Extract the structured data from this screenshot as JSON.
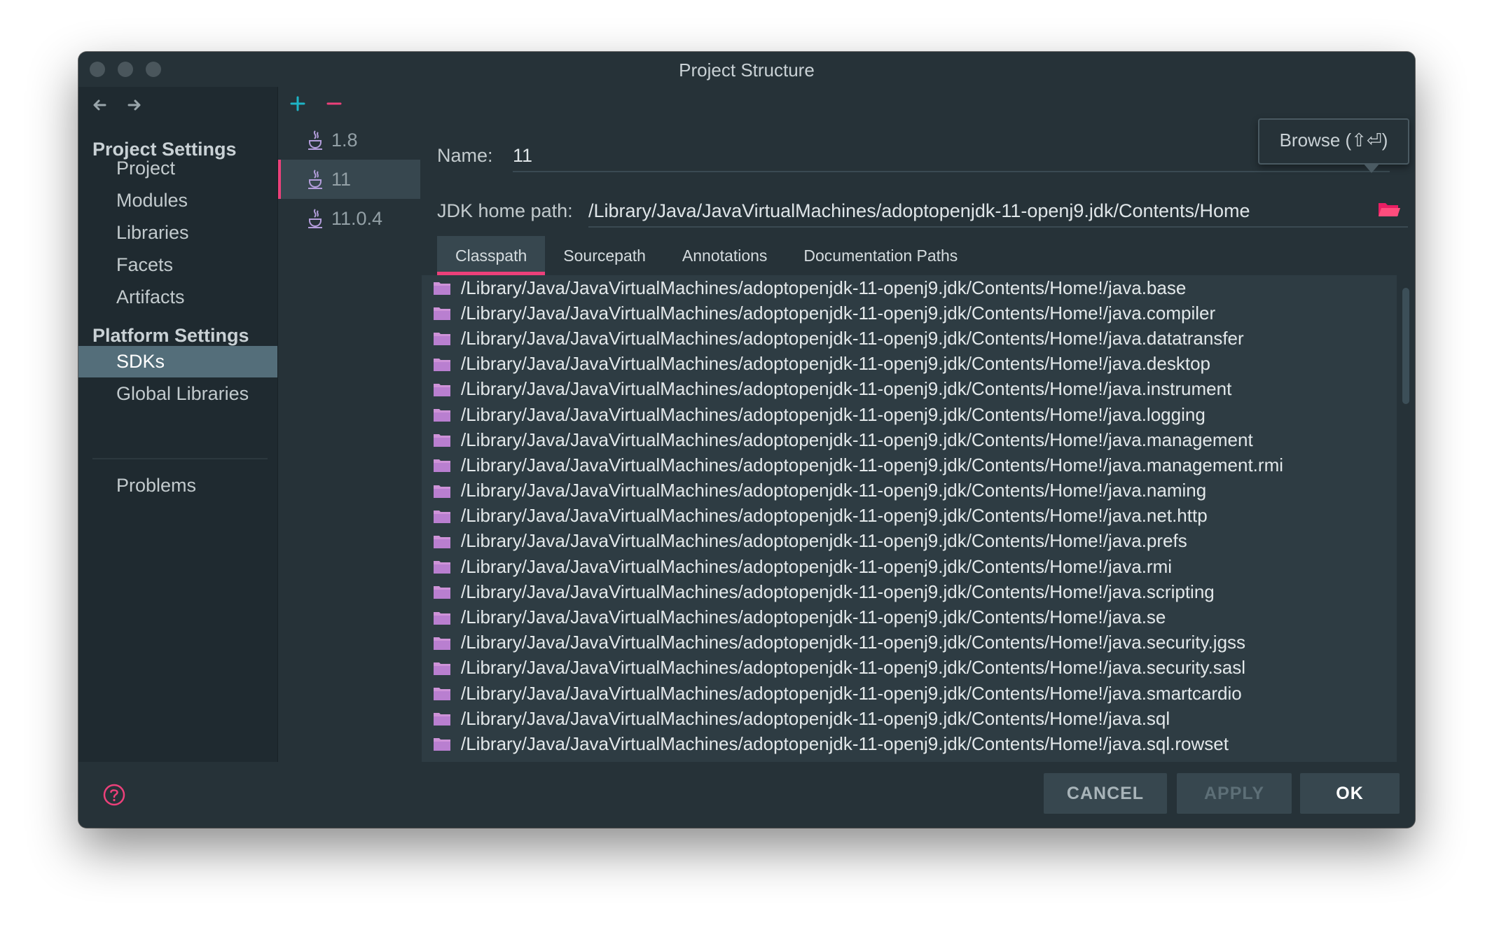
{
  "window": {
    "title": "Project Structure"
  },
  "colors": {
    "accent": "#ec407a",
    "add": "#1db4c6",
    "folder": "#ce93d8",
    "selection": "#546e7a"
  },
  "sidebar": {
    "groups": [
      {
        "label": "Project Settings",
        "items": [
          "Project",
          "Modules",
          "Libraries",
          "Facets",
          "Artifacts"
        ]
      },
      {
        "label": "Platform Settings",
        "items": [
          "SDKs",
          "Global Libraries"
        ]
      }
    ],
    "selected": "SDKs",
    "problems": "Problems"
  },
  "sdks": {
    "items": [
      "1.8",
      "11",
      "11.0.4"
    ],
    "selected": "11"
  },
  "form": {
    "name_label": "Name:",
    "name_value": "11",
    "jdk_label": "JDK home path:",
    "jdk_value": "/Library/Java/JavaVirtualMachines/adoptopenjdk-11-openj9.jdk/Contents/Home",
    "browse_tooltip": "Browse (⇧⏎)"
  },
  "tabs": [
    "Classpath",
    "Sourcepath",
    "Annotations",
    "Documentation Paths"
  ],
  "active_tab": "Classpath",
  "classpath": [
    "/Library/Java/JavaVirtualMachines/adoptopenjdk-11-openj9.jdk/Contents/Home!/java.base",
    "/Library/Java/JavaVirtualMachines/adoptopenjdk-11-openj9.jdk/Contents/Home!/java.compiler",
    "/Library/Java/JavaVirtualMachines/adoptopenjdk-11-openj9.jdk/Contents/Home!/java.datatransfer",
    "/Library/Java/JavaVirtualMachines/adoptopenjdk-11-openj9.jdk/Contents/Home!/java.desktop",
    "/Library/Java/JavaVirtualMachines/adoptopenjdk-11-openj9.jdk/Contents/Home!/java.instrument",
    "/Library/Java/JavaVirtualMachines/adoptopenjdk-11-openj9.jdk/Contents/Home!/java.logging",
    "/Library/Java/JavaVirtualMachines/adoptopenjdk-11-openj9.jdk/Contents/Home!/java.management",
    "/Library/Java/JavaVirtualMachines/adoptopenjdk-11-openj9.jdk/Contents/Home!/java.management.rmi",
    "/Library/Java/JavaVirtualMachines/adoptopenjdk-11-openj9.jdk/Contents/Home!/java.naming",
    "/Library/Java/JavaVirtualMachines/adoptopenjdk-11-openj9.jdk/Contents/Home!/java.net.http",
    "/Library/Java/JavaVirtualMachines/adoptopenjdk-11-openj9.jdk/Contents/Home!/java.prefs",
    "/Library/Java/JavaVirtualMachines/adoptopenjdk-11-openj9.jdk/Contents/Home!/java.rmi",
    "/Library/Java/JavaVirtualMachines/adoptopenjdk-11-openj9.jdk/Contents/Home!/java.scripting",
    "/Library/Java/JavaVirtualMachines/adoptopenjdk-11-openj9.jdk/Contents/Home!/java.se",
    "/Library/Java/JavaVirtualMachines/adoptopenjdk-11-openj9.jdk/Contents/Home!/java.security.jgss",
    "/Library/Java/JavaVirtualMachines/adoptopenjdk-11-openj9.jdk/Contents/Home!/java.security.sasl",
    "/Library/Java/JavaVirtualMachines/adoptopenjdk-11-openj9.jdk/Contents/Home!/java.smartcardio",
    "/Library/Java/JavaVirtualMachines/adoptopenjdk-11-openj9.jdk/Contents/Home!/java.sql",
    "/Library/Java/JavaVirtualMachines/adoptopenjdk-11-openj9.jdk/Contents/Home!/java.sql.rowset"
  ],
  "buttons": {
    "cancel": "CANCEL",
    "apply": "APPLY",
    "ok": "OK"
  },
  "icons": {
    "back": "arrow-left-icon",
    "forward": "arrow-right-icon",
    "add": "plus-icon",
    "remove": "minus-icon",
    "sdk": "java-cup-icon",
    "folder": "folder-icon",
    "help": "question-icon"
  }
}
